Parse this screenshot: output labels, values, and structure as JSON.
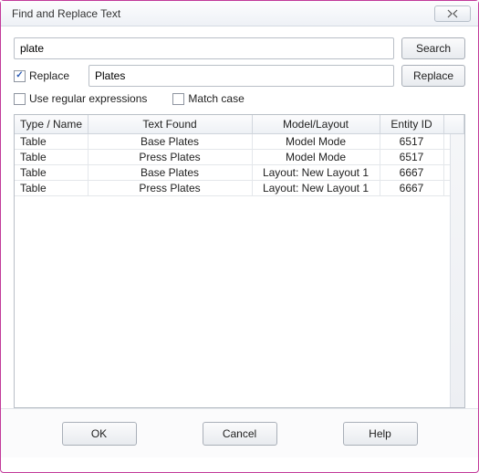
{
  "window": {
    "title": "Find and Replace Text"
  },
  "search": {
    "value": "plate",
    "button": "Search"
  },
  "replace": {
    "checkbox_label": "Replace",
    "checked": true,
    "value": "Plates",
    "button": "Replace"
  },
  "options": {
    "regex_label": "Use regular expressions",
    "regex_checked": false,
    "matchcase_label": "Match case",
    "matchcase_checked": false
  },
  "grid": {
    "headers": {
      "type_name": "Type / Name",
      "text_found": "Text Found",
      "model_layout": "Model/Layout",
      "entity_id": "Entity ID"
    },
    "rows": [
      {
        "type_name": "Table",
        "text_found": "Base Plates",
        "model_layout": "Model Mode",
        "entity_id": "6517"
      },
      {
        "type_name": "Table",
        "text_found": "Press Plates",
        "model_layout": "Model Mode",
        "entity_id": "6517"
      },
      {
        "type_name": "Table",
        "text_found": "Base Plates",
        "model_layout": "Layout: New Layout 1",
        "entity_id": "6667"
      },
      {
        "type_name": "Table",
        "text_found": "Press Plates",
        "model_layout": "Layout: New Layout 1",
        "entity_id": "6667"
      }
    ]
  },
  "footer": {
    "ok": "OK",
    "cancel": "Cancel",
    "help": "Help"
  }
}
